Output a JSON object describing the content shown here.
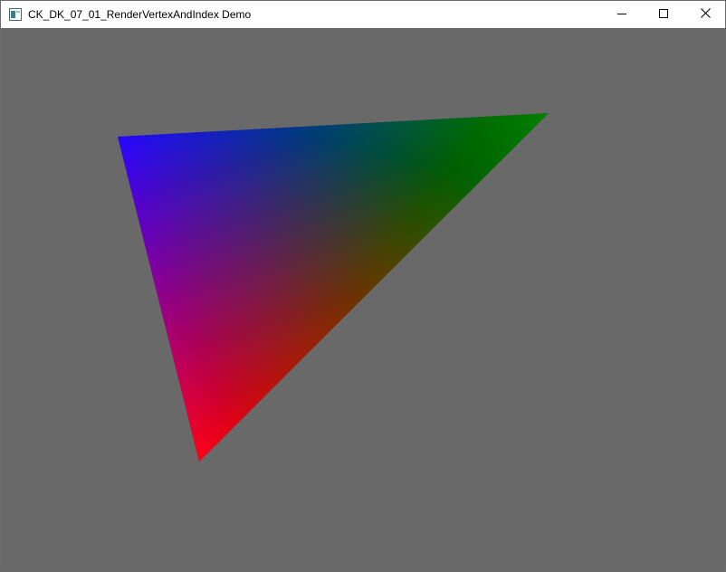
{
  "window": {
    "title": "CK_DK_07_01_RenderVertexAndIndex Demo",
    "icon": "app-window-icon",
    "controls": {
      "minimize_icon": "minimize-icon",
      "maximize_icon": "maximize-icon",
      "close_icon": "close-icon"
    }
  },
  "viewport": {
    "clear_color": "#696969",
    "triangle": {
      "vertex_colors": [
        "#0000ff",
        "#008000",
        "#ff0000"
      ]
    }
  }
}
